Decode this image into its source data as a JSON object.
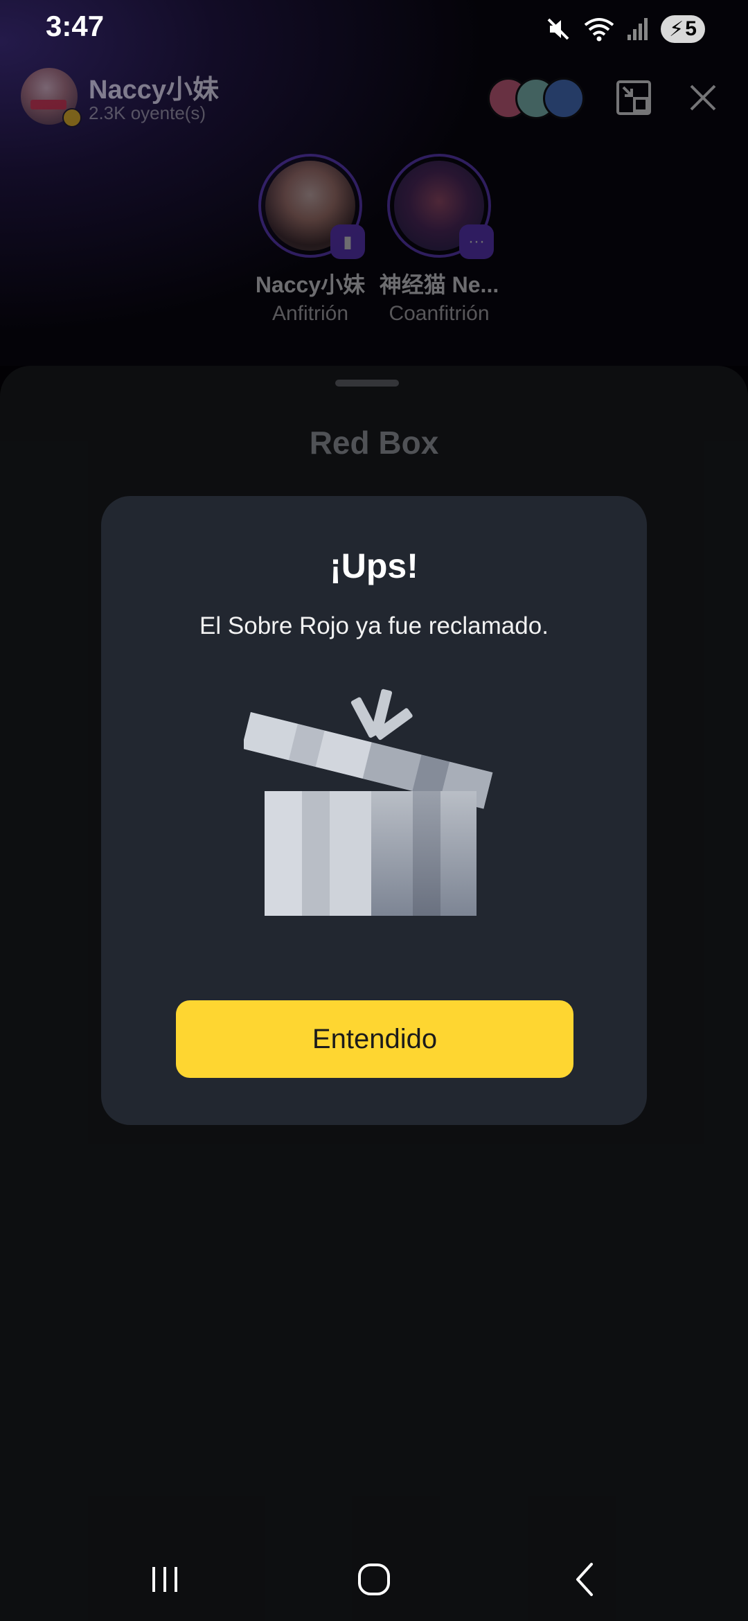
{
  "status_bar": {
    "time": "3:47",
    "battery_level": "5",
    "icons": [
      "mute-icon",
      "wifi-icon",
      "signal-icon",
      "battery-charging-icon"
    ]
  },
  "room": {
    "host_name": "Naccy小妹",
    "listeners": "2.3K oyente(s)",
    "speakers": [
      {
        "name": "Naccy小妹",
        "role": "Anfitrión",
        "badge_icon": "audio-wave-icon"
      },
      {
        "name": "神经猫 Ne...",
        "role": "Coanfitrión",
        "badge_icon": "more-icon"
      }
    ],
    "header_icons": [
      "minimize-window-icon",
      "close-icon"
    ]
  },
  "sheet": {
    "title": "Red Box"
  },
  "modal": {
    "title": "¡Ups!",
    "message": "El Sobre Rojo ya fue reclamado.",
    "illustration": "open-gift-box-icon",
    "button_label": "Entendido"
  },
  "colors": {
    "accent_button": "#fed631",
    "modal_bg": "#222730",
    "sheet_bg": "#17191d",
    "speaker_ring": "#6a43d6"
  },
  "nav_bar": {
    "icons": [
      "recent-apps-icon",
      "home-icon",
      "back-icon"
    ]
  }
}
